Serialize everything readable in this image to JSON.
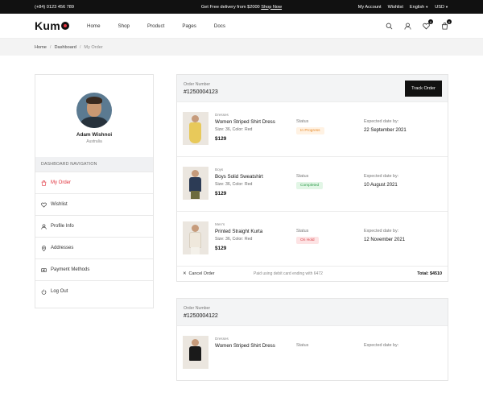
{
  "topbar": {
    "phone": "(+84) 0123 456 789",
    "promo_text": "Get Free delivery from $2000",
    "promo_link": "Shop Now",
    "my_account": "My Account",
    "wishlist": "Wishlist",
    "language": "English",
    "currency": "USD"
  },
  "header": {
    "logo": "Kum",
    "menu": [
      "Home",
      "Shop",
      "Product",
      "Pages",
      "Docs"
    ],
    "wishlist_count": "0",
    "cart_count": "0"
  },
  "breadcrumb": {
    "home": "Home",
    "dashboard": "Dashboard",
    "current": "My Order"
  },
  "profile": {
    "name": "Adam Wishnoi",
    "location": "Australia"
  },
  "sidebar": {
    "heading": "DASHBOARD NAVIGATION",
    "items": [
      {
        "label": "My Order",
        "icon": "bag-icon"
      },
      {
        "label": "Wishlist",
        "icon": "heart-icon"
      },
      {
        "label": "Profile Info",
        "icon": "user-icon"
      },
      {
        "label": "Addresses",
        "icon": "map-pin-icon"
      },
      {
        "label": "Payment Methods",
        "icon": "card-icon"
      },
      {
        "label": "Log Out",
        "icon": "power-icon"
      }
    ]
  },
  "orders": [
    {
      "number_label": "Order Number",
      "number": "#1250004123",
      "track_label": "Track Order",
      "items": [
        {
          "category": "Dresses",
          "name": "Women Striped Shirt Dress",
          "variant": "Size: 36, Color: Red",
          "price": "$129",
          "status_label": "Status",
          "status": "In Progress",
          "date_label": "Expected date by:",
          "date": "22 September 2021"
        },
        {
          "category": "Boys",
          "name": "Boys Solid Sweatshirt",
          "variant": "Size: 36, Color: Red",
          "price": "$129",
          "status_label": "Status",
          "status": "Completed",
          "date_label": "Expected date by:",
          "date": "10 August 2021"
        },
        {
          "category": "Men's",
          "name": "Printed Straight Kurta",
          "variant": "Size: 36, Color: Red",
          "price": "$129",
          "status_label": "Status",
          "status": "On Hold",
          "date_label": "Expected date by:",
          "date": "12 November 2021"
        }
      ],
      "cancel_label": "Cancel Order",
      "payment_note": "Paid using debit card ending with 6472",
      "total": "Total: $4510"
    },
    {
      "number_label": "Order Number",
      "number": "#1250004122",
      "items": [
        {
          "category": "Dresses",
          "name": "Women Striped Shirt Dress",
          "status_label": "Status",
          "date_label": "Expected date by:"
        }
      ]
    }
  ],
  "colors": {
    "accent": "#e0323c",
    "dark": "#111111",
    "in_progress_bg": "#fff2e3",
    "in_progress_fg": "#e88a2a",
    "completed_bg": "#e2f6e6",
    "completed_fg": "#2e9b4a",
    "on_hold_bg": "#fde3e4",
    "on_hold_fg": "#d9434b"
  }
}
